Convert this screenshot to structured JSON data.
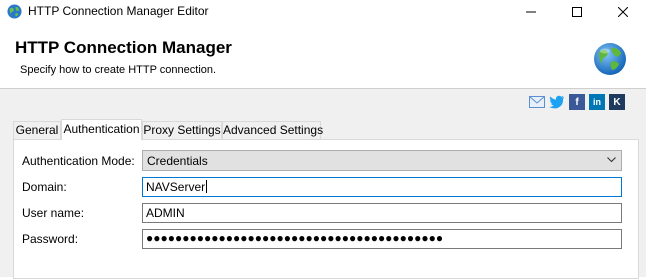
{
  "window": {
    "title": "HTTP Connection Manager Editor",
    "controls": [
      "minimize-icon",
      "maximize-icon",
      "close-icon"
    ]
  },
  "header": {
    "title": "HTTP Connection Manager",
    "subtitle": "Specify how to create HTTP connection.",
    "icon": "globe-icon"
  },
  "social": [
    {
      "name": "email-icon",
      "color": "#5b8fd0"
    },
    {
      "name": "twitter-icon",
      "color": "#1da1f2"
    },
    {
      "name": "facebook-icon",
      "color": "#3b5998"
    },
    {
      "name": "linkedin-icon",
      "color": "#0077b5"
    },
    {
      "name": "kingswaysoft-icon",
      "color": "#1e3a5f"
    }
  ],
  "tabs": [
    {
      "label": "General",
      "active": false
    },
    {
      "label": "Authentication",
      "active": true
    },
    {
      "label": "Proxy Settings",
      "active": false
    },
    {
      "label": "Advanced Settings",
      "active": false
    }
  ],
  "form": {
    "auth_mode": {
      "label": "Authentication Mode:",
      "value": "Credentials"
    },
    "domain": {
      "label": "Domain:",
      "value": "NAVServer"
    },
    "username": {
      "label": "User name:",
      "value": "ADMIN"
    },
    "password": {
      "label": "Password:",
      "value": "●●●●●●●●●●●●●●●●●●●●●●●●●●●●●●●●●●●●●●●●●"
    }
  },
  "colors": {
    "focus_border": "#0078d7",
    "panel_bg": "#f0f0f0"
  }
}
